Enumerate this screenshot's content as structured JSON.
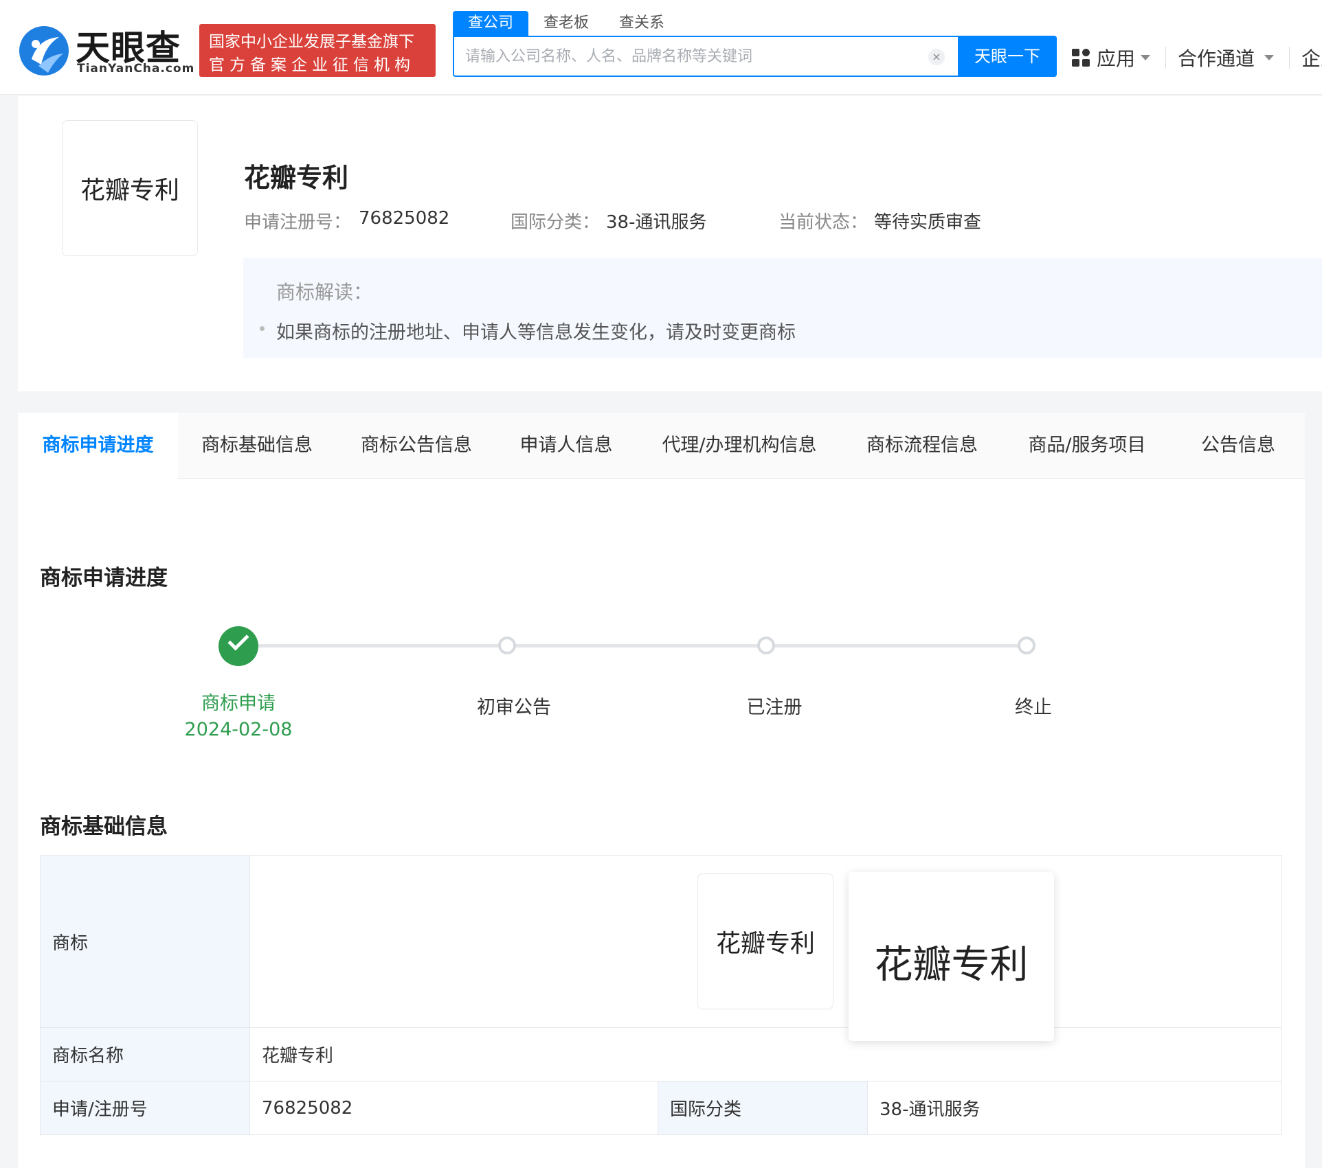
{
  "header": {
    "brand_name": "天眼查",
    "brand_domain": "TianYanCha.com",
    "badge_line1": "国家中小企业发展子基金旗下",
    "badge_line2": "官方备案企业征信机构",
    "search_tabs": [
      "查公司",
      "查老板",
      "查关系"
    ],
    "search_placeholder": "请输入公司名称、人名、品牌名称等关键词",
    "search_value": "",
    "search_button": "天眼一下",
    "clear_symbol": "×",
    "nav": {
      "apps": "应用",
      "partner": "合作通道",
      "enterprise": "企业"
    },
    "colors": {
      "brand_blue": "#0084ff",
      "badge_red": "#d9413a"
    }
  },
  "trademark": {
    "logo_text": "花瓣专利",
    "title": "花瓣专利",
    "reg_no_label": "申请注册号：",
    "reg_no": "76825082",
    "intl_class_label": "国际分类：",
    "intl_class": "38-通讯服务",
    "status_label": "当前状态：",
    "status": "等待实质审查",
    "interpretation_title": "商标解读：",
    "interpretation_items": [
      "如果商标的注册地址、申请人等信息发生变化，请及时变更商标"
    ]
  },
  "tabs": [
    "商标申请进度",
    "商标基础信息",
    "商标公告信息",
    "申请人信息",
    "代理/办理机构信息",
    "商标流程信息",
    "商品/服务项目",
    "公告信息"
  ],
  "progress": {
    "title": "商标申请进度",
    "steps": [
      {
        "label": "商标申请",
        "date": "2024-02-08",
        "done": true
      },
      {
        "label": "初审公告",
        "date": "",
        "done": false
      },
      {
        "label": "已注册",
        "date": "",
        "done": false
      },
      {
        "label": "终止",
        "date": "",
        "done": false
      }
    ],
    "done_color": "#2e9d4e"
  },
  "basic_info": {
    "title": "商标基础信息",
    "rows": {
      "trademark_label": "商标",
      "name_label": "商标名称",
      "name_value": "花瓣专利",
      "reg_label": "申请/注册号",
      "reg_value": "76825082",
      "class_label": "国际分类",
      "class_value": "38-通讯服务"
    },
    "image_text": "花瓣专利"
  }
}
